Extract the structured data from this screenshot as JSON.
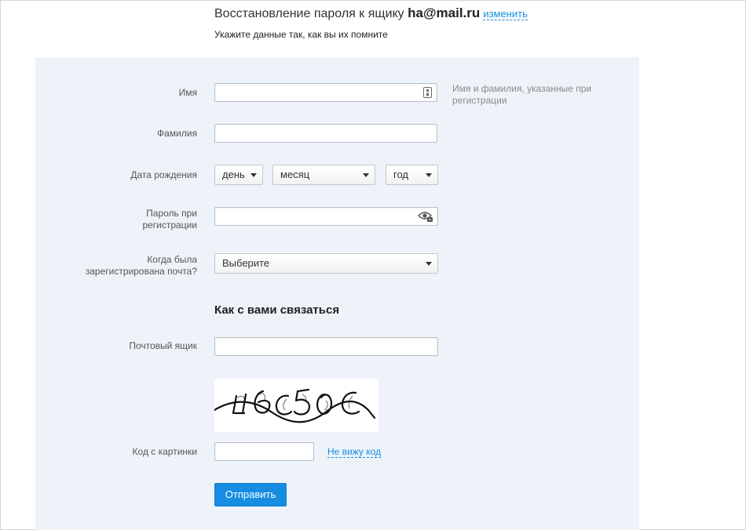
{
  "header": {
    "title_prefix": "Восстановление пароля к ящику ",
    "email": "ha@mail.ru",
    "change_link": "изменить",
    "subtitle": "Укажите данные так, как вы их помните"
  },
  "form": {
    "first_name": {
      "label": "Имя",
      "value": "",
      "hint": "Имя и фамилия, указанные при регистрации",
      "icon": "contact-card-icon"
    },
    "last_name": {
      "label": "Фамилия",
      "value": ""
    },
    "birth_date": {
      "label": "Дата рождения",
      "day": "день",
      "month": "месяц",
      "year": "год"
    },
    "password": {
      "label_line1": "Пароль при",
      "label_line2": "регистрации",
      "value": "",
      "icon": "eye-icon"
    },
    "reg_date": {
      "label_line1": "Когда была",
      "label_line2": "зарегистрирована почта?",
      "value": "Выберите"
    }
  },
  "contact": {
    "section_title": "Как с вами связаться",
    "mailbox": {
      "label": "Почтовый ящик",
      "value": ""
    },
    "captcha": {
      "label": "Код с картинки",
      "value": "",
      "cant_see_link": "Не вижу код",
      "image_text": "ш6с5бс"
    }
  },
  "submit_label": "Отправить",
  "colors": {
    "accent": "#168de2",
    "panel_bg": "#eef3f9",
    "hint": "#8a8a8a"
  }
}
